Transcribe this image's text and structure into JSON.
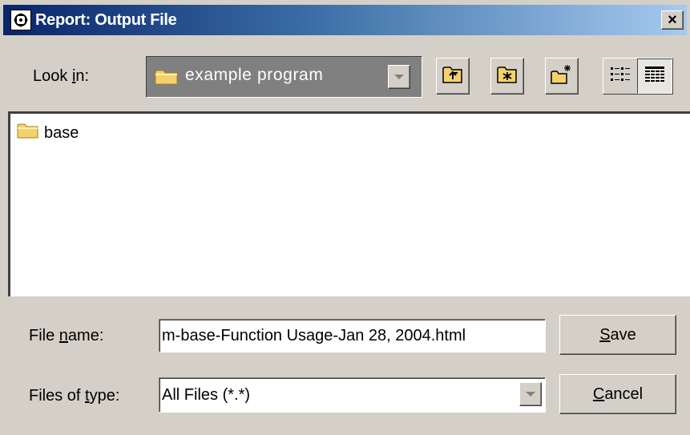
{
  "window": {
    "title": "Report: Output File",
    "icon": "app-crosshair-icon",
    "close_label": "×"
  },
  "toolbar": {
    "lookin_label_pre": "Look ",
    "lookin_label_key": "i",
    "lookin_label_post": "n:",
    "lookin_value": "example program",
    "buttons": [
      "up-one-level-icon",
      "home-folder-icon",
      "new-folder-icon",
      "list-view-icon",
      "details-view-icon"
    ]
  },
  "files": [
    {
      "name": "base",
      "icon": "folder-icon"
    }
  ],
  "filename": {
    "label_pre": "File ",
    "label_key": "n",
    "label_post": "ame:",
    "value": "m-base-Function Usage-Jan 28, 2004.html"
  },
  "filetype": {
    "label_pre": "Files of ",
    "label_key": "t",
    "label_post": "ype:",
    "value": "All Files (*.*)"
  },
  "actions": {
    "save_key": "S",
    "save_rest": "ave",
    "cancel_key": "C",
    "cancel_rest": "ancel"
  },
  "colors": {
    "titlebar_start": "#0a246a",
    "titlebar_end": "#a6caf0",
    "face": "#d4d0c8",
    "folder": "#f5d16b"
  }
}
